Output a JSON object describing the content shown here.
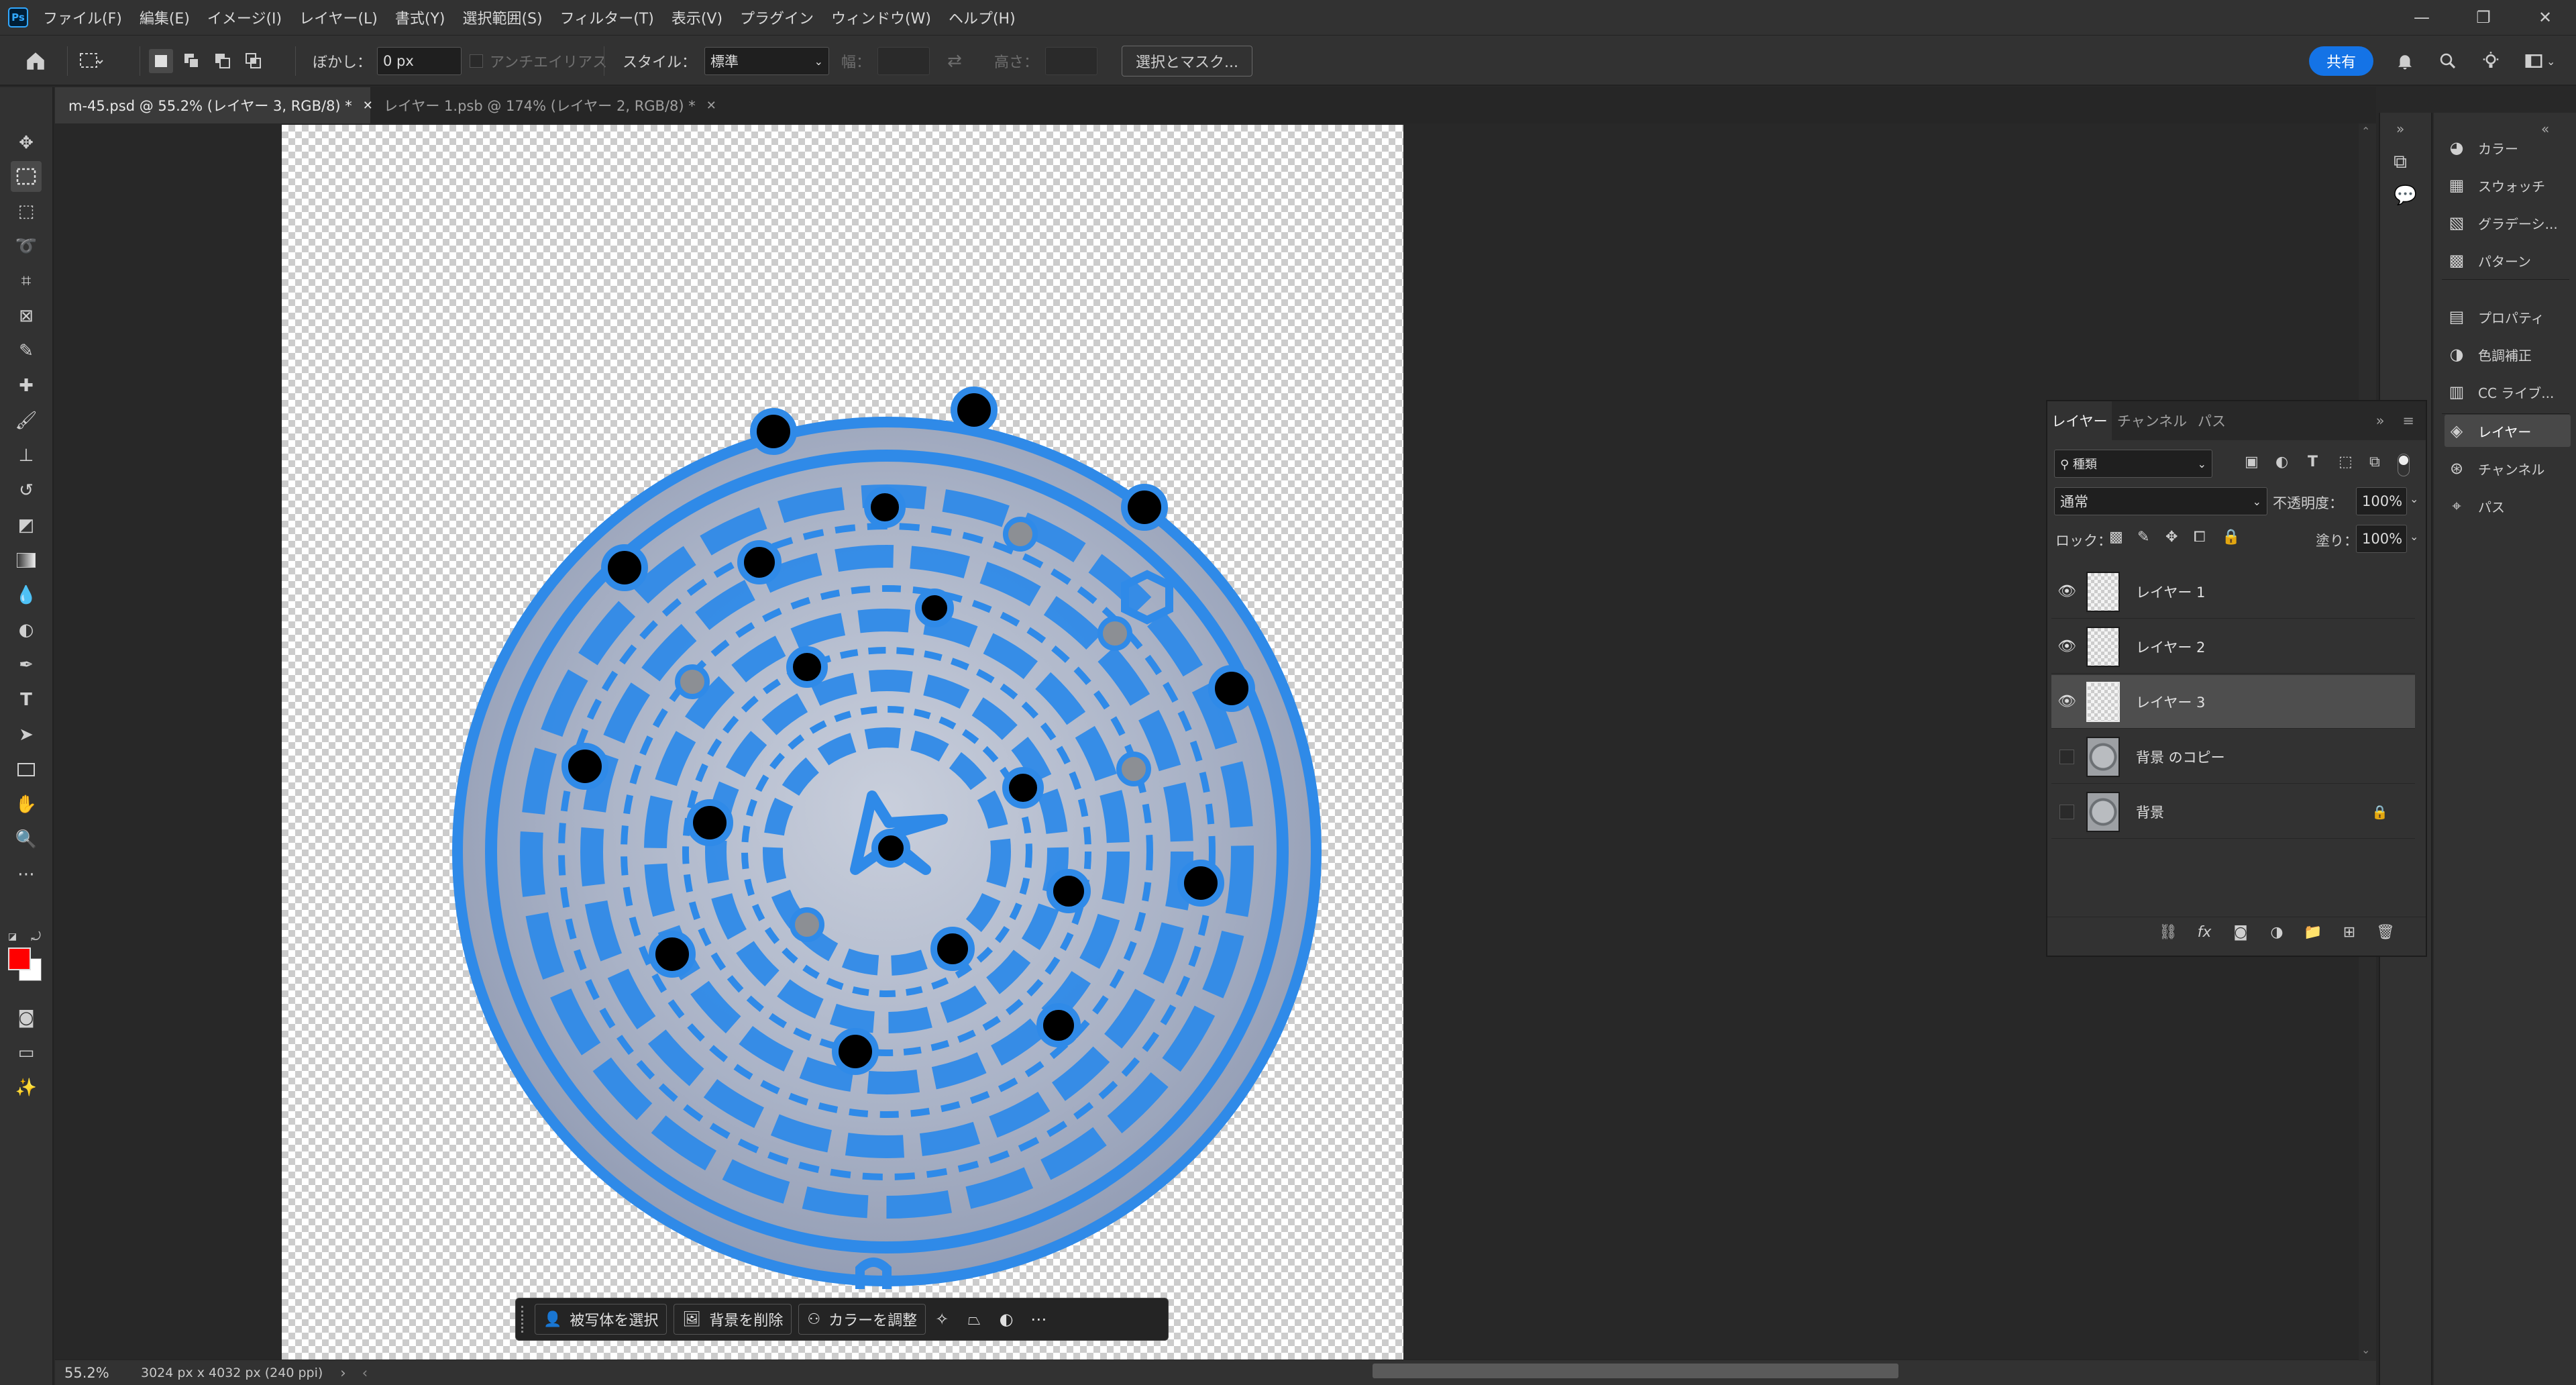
{
  "app": {
    "logo": "Ps",
    "menu": [
      "ファイル(F)",
      "編集(E)",
      "イメージ(I)",
      "レイヤー(L)",
      "書式(Y)",
      "選択範囲(S)",
      "フィルター(T)",
      "表示(V)",
      "プラグイン",
      "ウィンドウ(W)",
      "ヘルプ(H)"
    ],
    "window_controls": [
      "minimize-icon",
      "restore-icon",
      "close-icon"
    ]
  },
  "options": {
    "feather_label": "ぼかし：",
    "feather_value": "0 px",
    "antialias_label": "アンチエイリアス",
    "style_label": "スタイル：",
    "style_value": "標準",
    "width_label": "幅：",
    "height_label": "高さ：",
    "select_mask": "選択とマスク...",
    "share": "共有"
  },
  "tabs": [
    {
      "label": "m-45.psd @ 55.2% (レイヤー 3, RGB/8) *",
      "active": true
    },
    {
      "label": "レイヤー 1.psb @ 174% (レイヤー 2, RGB/8) *",
      "active": false
    }
  ],
  "taskbar": {
    "select_subject": "被写体を選択",
    "remove_bg": "背景を削除",
    "adjust_color": "カラーを調整"
  },
  "status": {
    "zoom": "55.2%",
    "doc_info": "3024 px x 4032 px (240 ppi)"
  },
  "dock": {
    "group1": [
      "カラー",
      "スウォッチ",
      "グラデーシ...",
      "パターン"
    ],
    "group2": [
      "プロパティ",
      "色調補正",
      "CC ライブ..."
    ],
    "group3": [
      "レイヤー",
      "チャンネル",
      "パス"
    ]
  },
  "layers_panel": {
    "tabs": [
      "レイヤー",
      "チャンネル",
      "パス"
    ],
    "filter_kind": "種類",
    "blend_mode": "通常",
    "opacity_label": "不透明度：",
    "opacity_value": "100%",
    "lock_label": "ロック：",
    "fill_label": "塗り：",
    "fill_value": "100%",
    "layers": [
      {
        "name": "レイヤー 1",
        "visible": true,
        "selected": false,
        "locked": false
      },
      {
        "name": "レイヤー 2",
        "visible": true,
        "selected": false,
        "locked": false
      },
      {
        "name": "レイヤー 3",
        "visible": true,
        "selected": true,
        "locked": false
      },
      {
        "name": "背景 のコピー",
        "visible": false,
        "selected": false,
        "locked": false
      },
      {
        "name": "背景",
        "visible": false,
        "selected": false,
        "locked": true
      }
    ]
  },
  "colors": {
    "accent": "#1473e6",
    "foreground": "#ff0000",
    "background": "#ffffff",
    "selection_blue": "#2f8ae8"
  }
}
